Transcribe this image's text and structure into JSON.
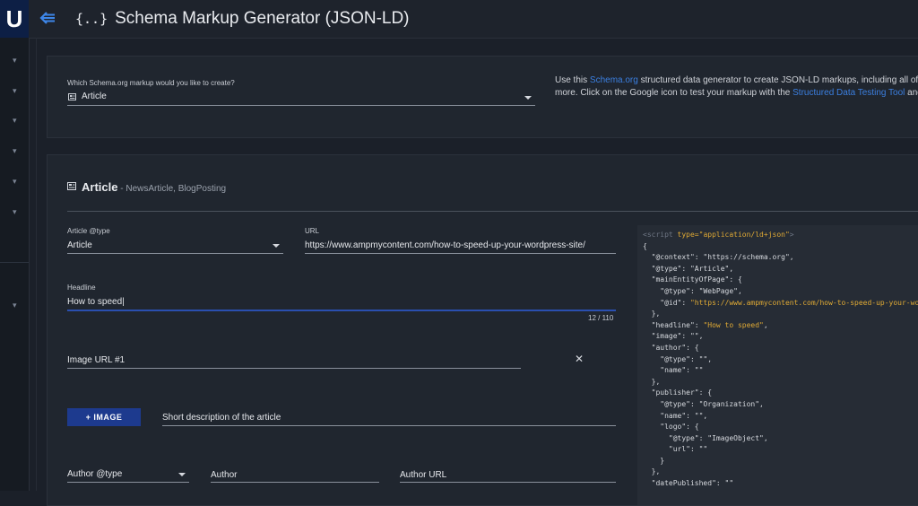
{
  "app": {
    "logo_text": "U",
    "title_icon": "{..}",
    "title": "Schema Markup Generator (JSON-LD)"
  },
  "selector": {
    "label": "Which Schema.org markup would you like to create?",
    "value": "Article"
  },
  "description": {
    "line1_prefix": "Use this ",
    "link1": "Schema.org",
    "line1_suffix": " structured data generator to create JSON-LD markups, including all of the re",
    "line2_prefix": "more. Click on the Google icon to test your markup with the ",
    "link2": "Structured Data Testing Tool",
    "line2_suffix": " and/or t"
  },
  "section": {
    "title": "Article",
    "subtitle": " - NewsArticle, BlogPosting"
  },
  "form": {
    "article_type_label": "Article @type",
    "article_type_value": "Article",
    "url_label": "URL",
    "url_value": "https://www.ampmycontent.com/how-to-speed-up-your-wordpress-site/",
    "headline_label": "Headline",
    "headline_value": "How to speed",
    "headline_counter": "12 / 110",
    "image_url_label": "Image URL #1",
    "image_button": "+ IMAGE",
    "short_desc_placeholder": "Short description of the article",
    "author_type_label": "Author @type",
    "author_label": "Author",
    "author_url_label": "Author URL"
  },
  "code": {
    "script_open": "<script",
    "type_attr": " type=",
    "type_value": "\"application/ld+json\"",
    "script_close": ">",
    "lines": [
      "{",
      "  \"@context\": \"https://schema.org\",",
      "  \"@type\": \"Article\",",
      "  \"mainEntityOfPage\": {",
      "    \"@type\": \"WebPage\","
    ],
    "id_key": "    \"@id\": ",
    "id_value": "\"https://www.ampmycontent.com/how-to-speed-up-your-wor",
    "lines2": [
      "  },"
    ],
    "headline_key": "  \"headline\": ",
    "headline_value": "\"How to speed\"",
    "headline_end": ",",
    "lines3": [
      "  \"image\": \"\",",
      "  \"author\": {",
      "    \"@type\": \"\",",
      "    \"name\": \"\"",
      "  },",
      "  \"publisher\": {",
      "    \"@type\": \"Organization\",",
      "    \"name\": \"\",",
      "    \"logo\": {",
      "      \"@type\": \"ImageObject\",",
      "      \"url\": \"\"",
      "    }",
      "  },",
      "  \"datePublished\": \"\""
    ]
  },
  "colors": {
    "background": "#1b2029",
    "card": "#20262f",
    "accent": "#1d3a8e",
    "link": "#3b7fe0",
    "code_highlight": "#e0aa35"
  }
}
